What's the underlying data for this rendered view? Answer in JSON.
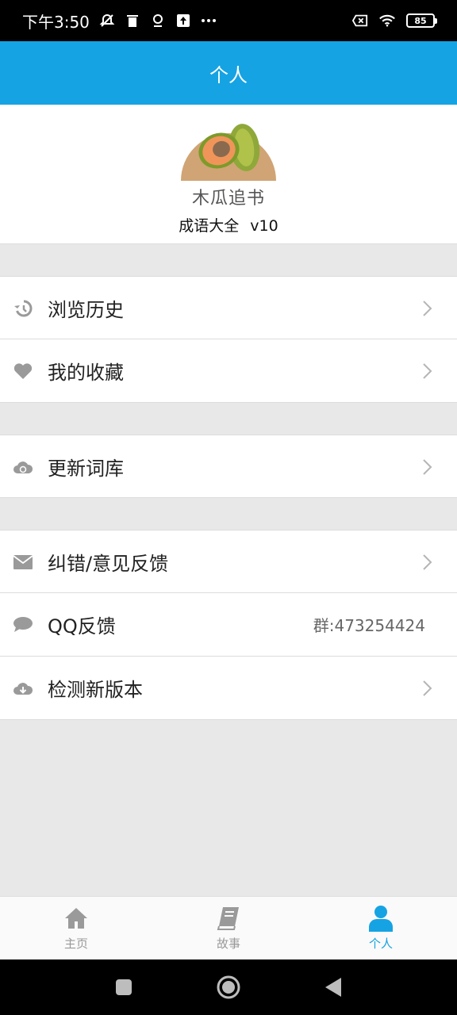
{
  "status_bar": {
    "time": "下午3:50",
    "icons_left": [
      "notification-muted-icon",
      "trash-icon",
      "location-icon",
      "upload-icon",
      "more-dots-icon"
    ],
    "icons_right": [
      "sim-off-icon",
      "wifi-icon",
      "battery-icon"
    ],
    "battery": "85"
  },
  "header": {
    "title": "个人"
  },
  "profile": {
    "avatar_icon": "papaya-avatar-icon",
    "avatar_caption": "木瓜追书",
    "app_name": "成语大全",
    "version": "v10"
  },
  "menu": {
    "browse_history": {
      "label": "浏览历史",
      "icon": "history-icon"
    },
    "favorites": {
      "label": "我的收藏",
      "icon": "heart-icon"
    },
    "update_library": {
      "label": "更新词库",
      "icon": "cloud-sync-icon"
    },
    "feedback": {
      "label": "纠错/意见反馈",
      "icon": "mail-icon"
    },
    "qq_feedback": {
      "label": "QQ反馈",
      "value": "群:473254424",
      "icon": "chat-icon"
    },
    "check_update": {
      "label": "检测新版本",
      "icon": "cloud-download-icon"
    }
  },
  "bottom_nav": {
    "home": {
      "label": "主页",
      "icon": "home-icon"
    },
    "stories": {
      "label": "故事",
      "icon": "book-icon"
    },
    "profile": {
      "label": "个人",
      "icon": "person-icon",
      "active": true
    }
  },
  "colors": {
    "accent": "#16a3e3",
    "background": "#e8e8e8",
    "icon_gray": "#9a9a9a"
  }
}
